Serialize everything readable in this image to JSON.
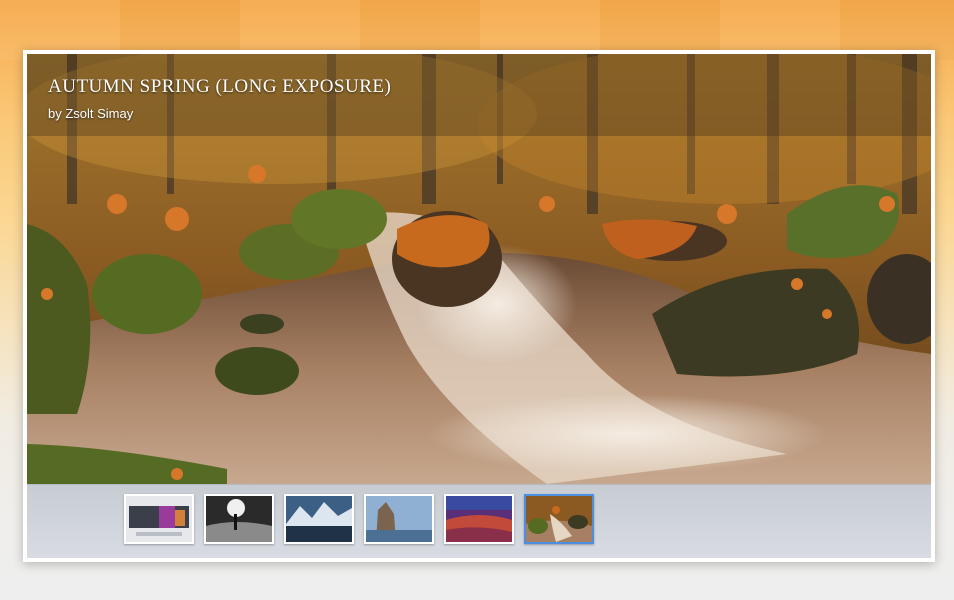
{
  "slide": {
    "title": "Autumn Spring (Long Exposure)",
    "author": "by Zsolt Simay"
  },
  "thumbnails": [
    {
      "name": "thumb-slider-demo",
      "active": false
    },
    {
      "name": "thumb-bw-figure",
      "active": false
    },
    {
      "name": "thumb-mountain-lake",
      "active": false
    },
    {
      "name": "thumb-rock-coast",
      "active": false
    },
    {
      "name": "thumb-purple-sunset",
      "active": false
    },
    {
      "name": "thumb-autumn-stream",
      "active": true
    }
  ],
  "colors": {
    "accent": "#4a8fe0",
    "thumb_bar": "#d3d7dd"
  }
}
